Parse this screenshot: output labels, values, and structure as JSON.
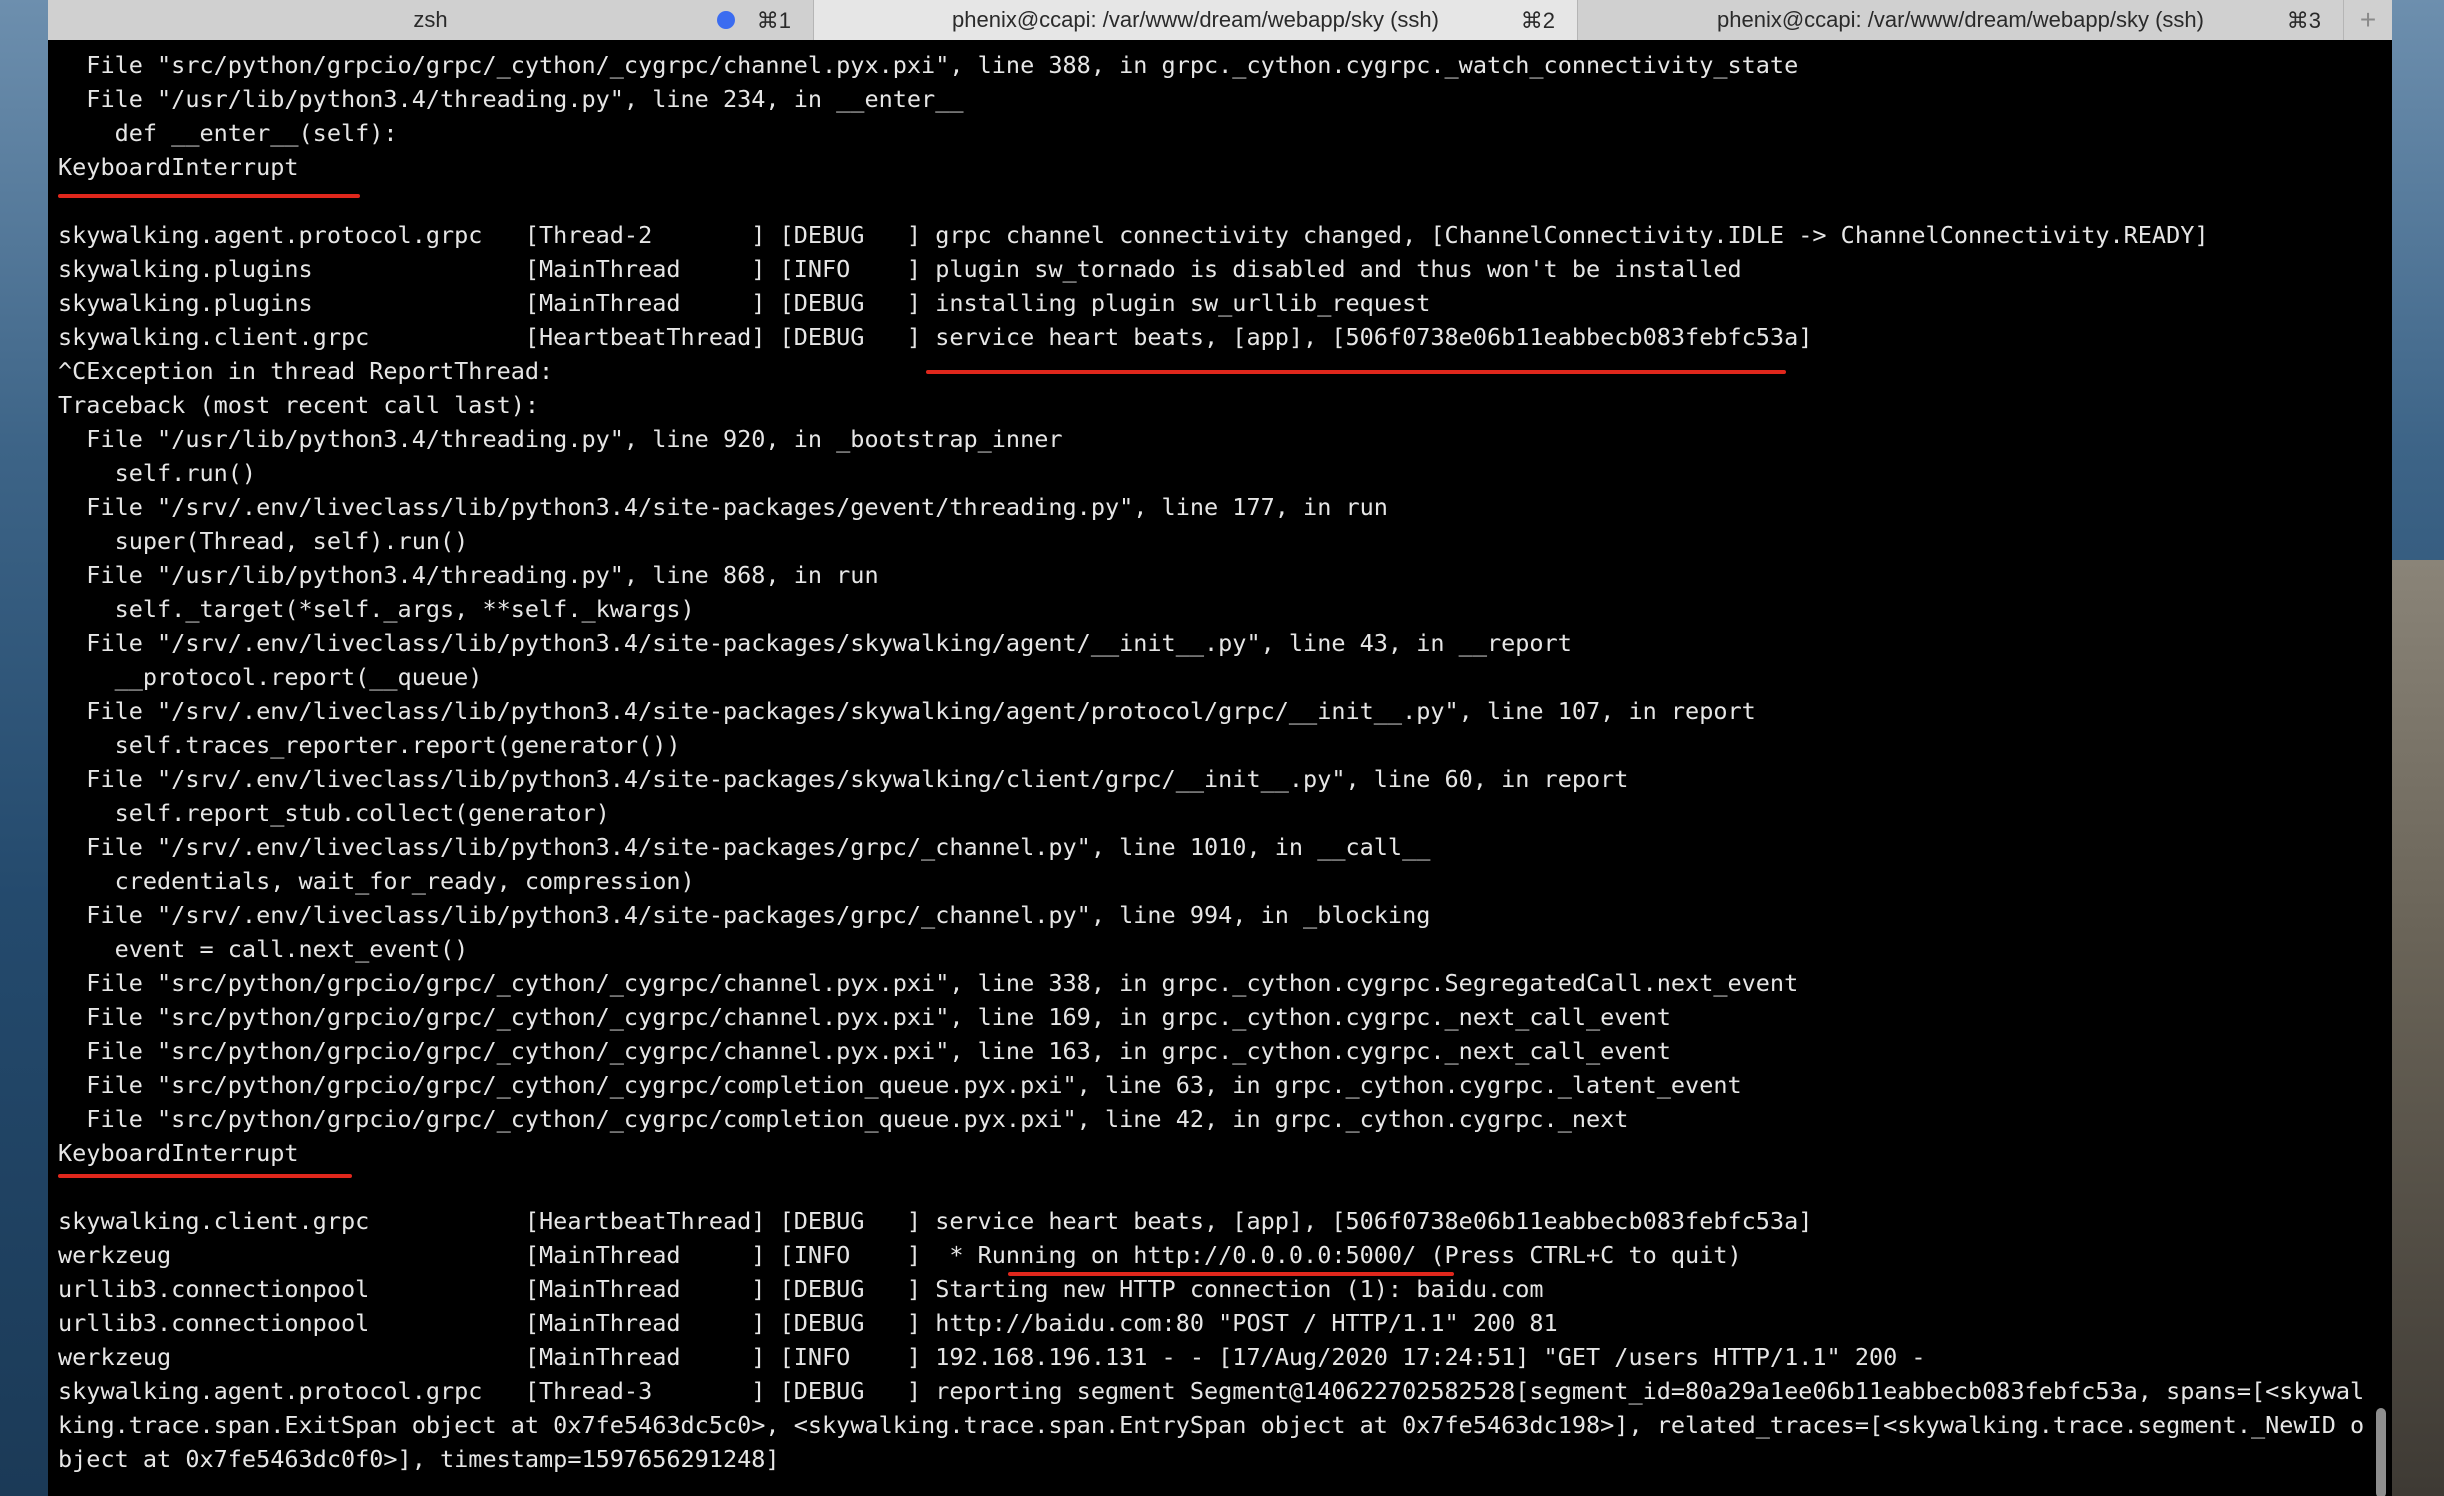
{
  "tabs": [
    {
      "label": "zsh",
      "shortcut": "⌘1",
      "activity_dot": true
    },
    {
      "label": "phenix@ccapi: /var/www/dream/webapp/sky (ssh)",
      "shortcut": "⌘2"
    },
    {
      "label": "phenix@ccapi: /var/www/dream/webapp/sky (ssh)",
      "shortcut": "⌘3"
    }
  ],
  "new_tab_label": "+",
  "colors": {
    "annotation_underline": "#e0271c",
    "terminal_bg": "#000000",
    "terminal_fg": "#e6e6e6"
  },
  "terminal": {
    "lines": [
      "  File \"src/python/grpcio/grpc/_cython/_cygrpc/channel.pyx.pxi\", line 388, in grpc._cython.cygrpc._watch_connectivity_state",
      "  File \"/usr/lib/python3.4/threading.py\", line 234, in __enter__",
      "    def __enter__(self):",
      "KeyboardInterrupt",
      "",
      "skywalking.agent.protocol.grpc   [Thread-2       ] [DEBUG   ] grpc channel connectivity changed, [ChannelConnectivity.IDLE -> ChannelConnectivity.READY]",
      "skywalking.plugins               [MainThread     ] [INFO    ] plugin sw_tornado is disabled and thus won't be installed",
      "skywalking.plugins               [MainThread     ] [DEBUG   ] installing plugin sw_urllib_request",
      "skywalking.client.grpc           [HeartbeatThread] [DEBUG   ] service heart beats, [app], [506f0738e06b11eabbecb083febfc53a]",
      "^CException in thread ReportThread:",
      "Traceback (most recent call last):",
      "  File \"/usr/lib/python3.4/threading.py\", line 920, in _bootstrap_inner",
      "    self.run()",
      "  File \"/srv/.env/liveclass/lib/python3.4/site-packages/gevent/threading.py\", line 177, in run",
      "    super(Thread, self).run()",
      "  File \"/usr/lib/python3.4/threading.py\", line 868, in run",
      "    self._target(*self._args, **self._kwargs)",
      "  File \"/srv/.env/liveclass/lib/python3.4/site-packages/skywalking/agent/__init__.py\", line 43, in __report",
      "    __protocol.report(__queue)",
      "  File \"/srv/.env/liveclass/lib/python3.4/site-packages/skywalking/agent/protocol/grpc/__init__.py\", line 107, in report",
      "    self.traces_reporter.report(generator())",
      "  File \"/srv/.env/liveclass/lib/python3.4/site-packages/skywalking/client/grpc/__init__.py\", line 60, in report",
      "    self.report_stub.collect(generator)",
      "  File \"/srv/.env/liveclass/lib/python3.4/site-packages/grpc/_channel.py\", line 1010, in __call__",
      "    credentials, wait_for_ready, compression)",
      "  File \"/srv/.env/liveclass/lib/python3.4/site-packages/grpc/_channel.py\", line 994, in _blocking",
      "    event = call.next_event()",
      "  File \"src/python/grpcio/grpc/_cython/_cygrpc/channel.pyx.pxi\", line 338, in grpc._cython.cygrpc.SegregatedCall.next_event",
      "  File \"src/python/grpcio/grpc/_cython/_cygrpc/channel.pyx.pxi\", line 169, in grpc._cython.cygrpc._next_call_event",
      "  File \"src/python/grpcio/grpc/_cython/_cygrpc/channel.pyx.pxi\", line 163, in grpc._cython.cygrpc._next_call_event",
      "  File \"src/python/grpcio/grpc/_cython/_cygrpc/completion_queue.pyx.pxi\", line 63, in grpc._cython.cygrpc._latent_event",
      "  File \"src/python/grpcio/grpc/_cython/_cygrpc/completion_queue.pyx.pxi\", line 42, in grpc._cython.cygrpc._next",
      "KeyboardInterrupt",
      "",
      "skywalking.client.grpc           [HeartbeatThread] [DEBUG   ] service heart beats, [app], [506f0738e06b11eabbecb083febfc53a]",
      "werkzeug                         [MainThread     ] [INFO    ]  * Running on http://0.0.0.0:5000/ (Press CTRL+C to quit)",
      "urllib3.connectionpool           [MainThread     ] [DEBUG   ] Starting new HTTP connection (1): baidu.com",
      "urllib3.connectionpool           [MainThread     ] [DEBUG   ] http://baidu.com:80 \"POST / HTTP/1.1\" 200 81",
      "werkzeug                         [MainThread     ] [INFO    ] 192.168.196.131 - - [17/Aug/2020 17:24:51] \"GET /users HTTP/1.1\" 200 -"
    ],
    "last_line": "skywalking.agent.protocol.grpc   [Thread-3       ] [DEBUG   ] reporting segment Segment@140622702582528[segment_id=80a29a1ee06b11eabbecb083febfc53a, spans=[<skywalking.trace.span.ExitSpan object at 0x7fe5463dc5c0>, <skywalking.trace.span.EntrySpan object at 0x7fe5463dc198>], related_traces=[<skywalking.trace.segment._NewID object at 0x7fe5463dc0f0>], timestamp=1597656291248]"
  }
}
